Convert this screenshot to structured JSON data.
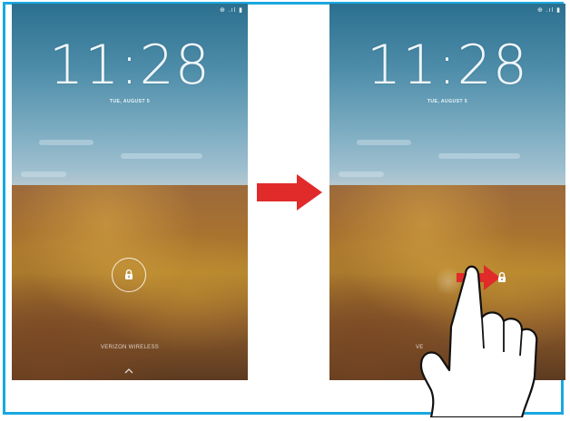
{
  "left_screen": {
    "status": "⊕ .ıl ▮",
    "time": "11:28",
    "date": "TUE, AUGUST 5",
    "carrier": "VERIZON WIRELESS"
  },
  "right_screen": {
    "status": "⊕ .ıl ▮",
    "time": "11:28",
    "date": "TUE, AUGUST 5",
    "carrier": "VE"
  },
  "colors": {
    "frame_border": "#1aa8e0",
    "arrow_red": "#e12a2a"
  },
  "icons": [
    "lock-icon",
    "chevron-up-icon",
    "arrow-right-icon",
    "hand-swipe-icon"
  ]
}
